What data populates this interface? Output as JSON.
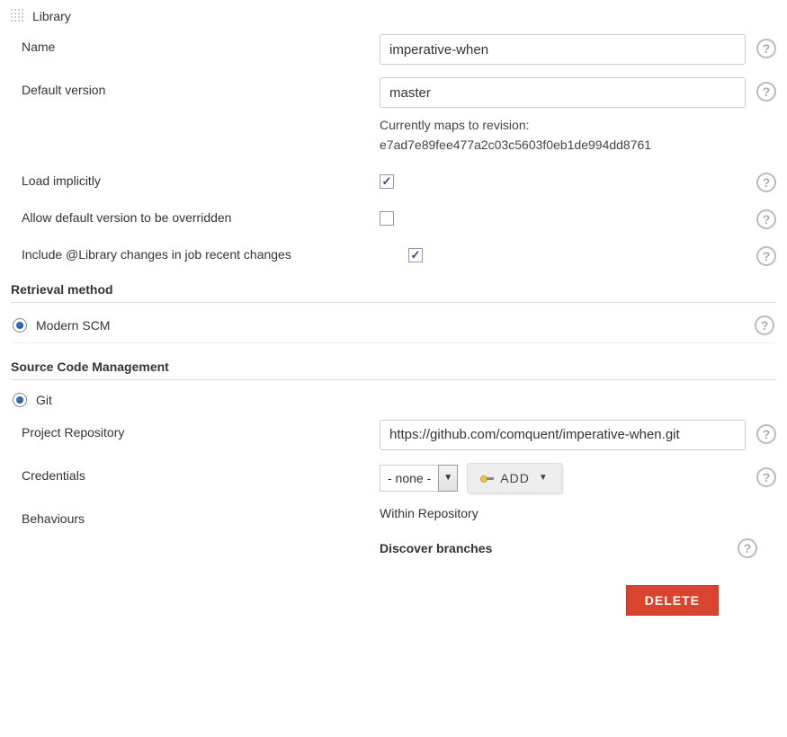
{
  "library": {
    "title": "Library",
    "name_label": "Name",
    "name_value": "imperative-when",
    "default_version_label": "Default version",
    "default_version_value": "master",
    "revision_note_prefix": "Currently maps to revision:",
    "revision_hash": "e7ad7e89fee477a2c03c5603f0eb1de994dd8761",
    "load_implicitly_label": "Load implicitly",
    "load_implicitly_checked": true,
    "allow_override_label": "Allow default version to be overridden",
    "allow_override_checked": false,
    "include_changes_label": "Include @Library changes in job recent changes",
    "include_changes_checked": true
  },
  "retrieval": {
    "heading": "Retrieval method",
    "option_modern_scm": "Modern SCM"
  },
  "scm": {
    "heading": "Source Code Management",
    "option_git": "Git",
    "repo_label": "Project Repository",
    "repo_value": "https://github.com/comquent/imperative-when.git",
    "credentials_label": "Credentials",
    "credentials_value": "- none -",
    "add_label": "ADD",
    "behaviours_label": "Behaviours",
    "within_repo": "Within Repository",
    "discover_branches": "Discover branches",
    "delete_label": "DELETE"
  }
}
